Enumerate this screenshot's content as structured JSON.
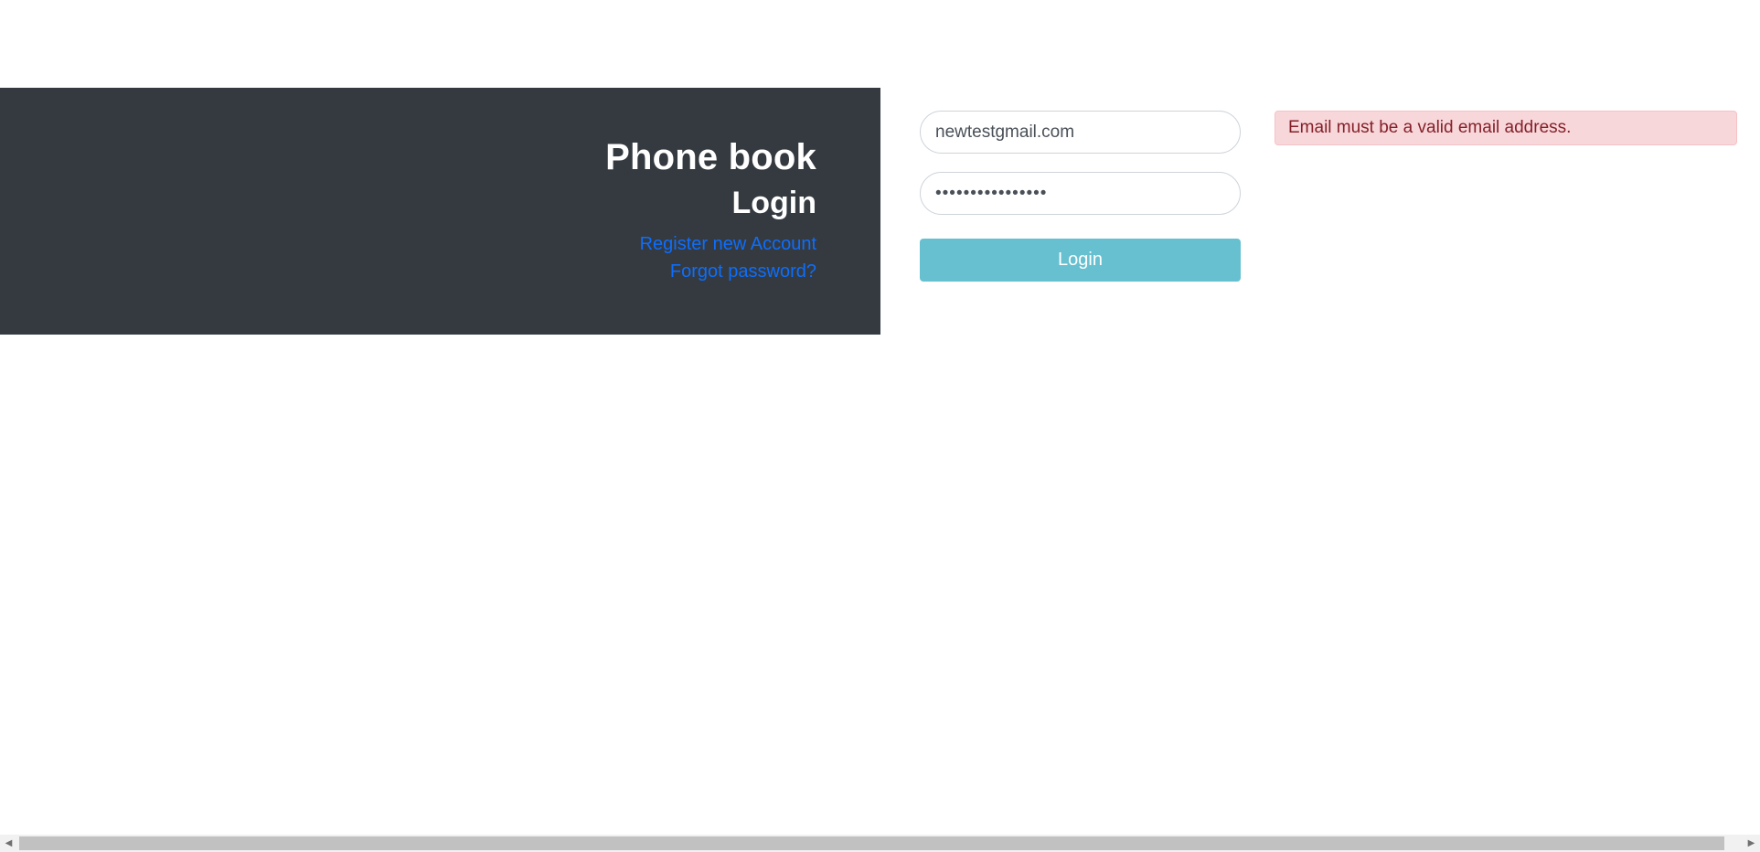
{
  "header": {
    "app_title": "Phone book",
    "page_heading": "Login",
    "register_link": "Register new Account",
    "forgot_link": "Forgot password?"
  },
  "form": {
    "email_value": "newtestgmail.com",
    "password_value": "••••••••••••••••",
    "login_button": "Login"
  },
  "alert": {
    "message": "Email must be a valid email address."
  },
  "scrollbar": {
    "left_arrow_icon": "triangle-left-icon",
    "right_arrow_icon": "triangle-right-icon"
  },
  "colors": {
    "header_bg": "#343a40",
    "link": "#0d6efd",
    "button_bg": "#66c0d0",
    "alert_bg": "#f8d7da",
    "alert_text": "#842029"
  }
}
